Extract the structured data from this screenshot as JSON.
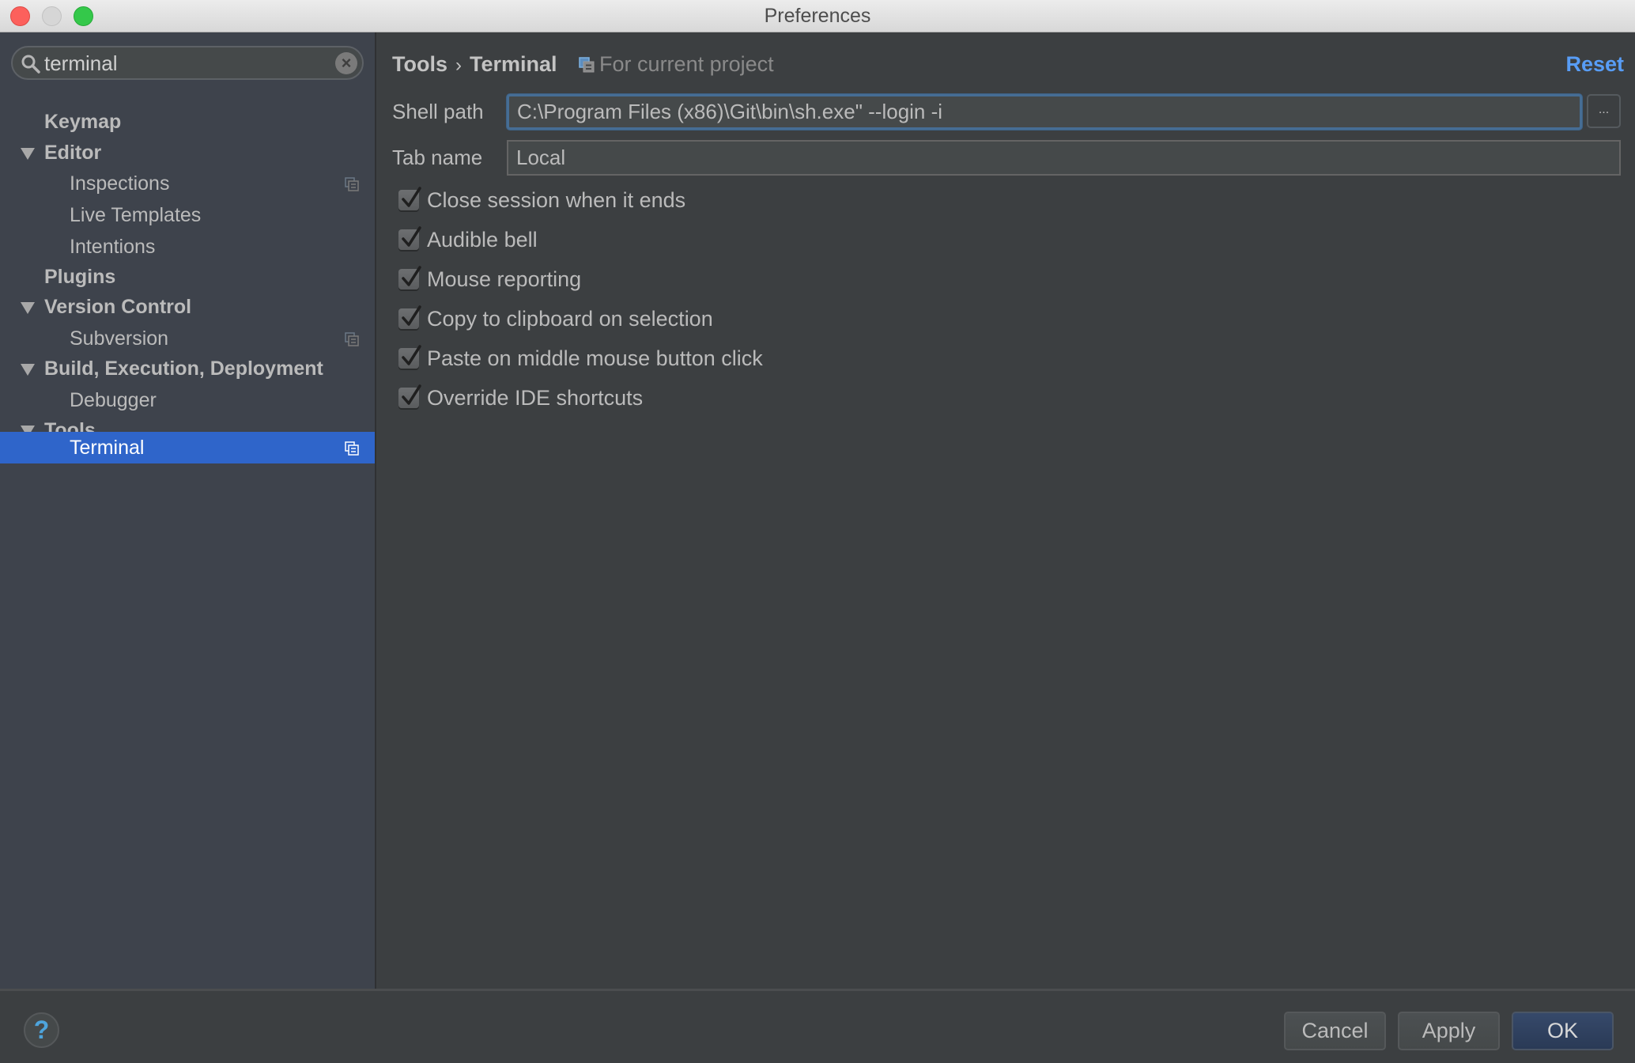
{
  "window": {
    "title": "Preferences"
  },
  "search": {
    "value": "terminal",
    "icon": "search-icon",
    "clear_icon": "clear-icon"
  },
  "sidebar": {
    "items": [
      {
        "label": "Keymap",
        "level": 0,
        "expandable": false
      },
      {
        "label": "Editor",
        "level": 0,
        "expandable": true,
        "expanded": true
      },
      {
        "label": "Inspections",
        "level": 1,
        "project_scoped": true
      },
      {
        "label": "Live Templates",
        "level": 1
      },
      {
        "label": "Intentions",
        "level": 1
      },
      {
        "label": "Plugins",
        "level": 0,
        "expandable": false
      },
      {
        "label": "Version Control",
        "level": 0,
        "expandable": true,
        "expanded": true
      },
      {
        "label": "Subversion",
        "level": 1,
        "project_scoped": true
      },
      {
        "label": "Build, Execution, Deployment",
        "level": 0,
        "expandable": true,
        "expanded": true
      },
      {
        "label": "Debugger",
        "level": 1
      },
      {
        "label": "Tools",
        "level": 0,
        "expandable": true,
        "expanded": true
      },
      {
        "label": "Terminal",
        "level": 1,
        "project_scoped": true,
        "selected": true
      }
    ]
  },
  "main": {
    "breadcrumb": {
      "parent": "Tools",
      "separator": "›",
      "current": "Terminal",
      "scope": "For current project"
    },
    "reset_label": "Reset",
    "shell_path": {
      "label": "Shell path",
      "value": "C:\\Program Files (x86)\\Git\\bin\\sh.exe\" --login -i",
      "browse_label": "..."
    },
    "tab_name": {
      "label": "Tab name",
      "value": "Local"
    },
    "checkboxes": [
      {
        "label": "Close session when it ends",
        "checked": true
      },
      {
        "label": "Audible bell",
        "checked": true
      },
      {
        "label": "Mouse reporting",
        "checked": true
      },
      {
        "label": "Copy to clipboard on selection",
        "checked": true
      },
      {
        "label": "Paste on middle mouse button click",
        "checked": true
      },
      {
        "label": "Override IDE shortcuts",
        "checked": true
      }
    ]
  },
  "footer": {
    "help_label": "?",
    "cancel_label": "Cancel",
    "apply_label": "Apply",
    "ok_label": "OK"
  },
  "colors": {
    "selection": "#2f65ca",
    "link": "#589df6",
    "sidebar_bg": "#3e434c",
    "panel_bg": "#3c3f41",
    "ok_button": "#2f4060"
  }
}
